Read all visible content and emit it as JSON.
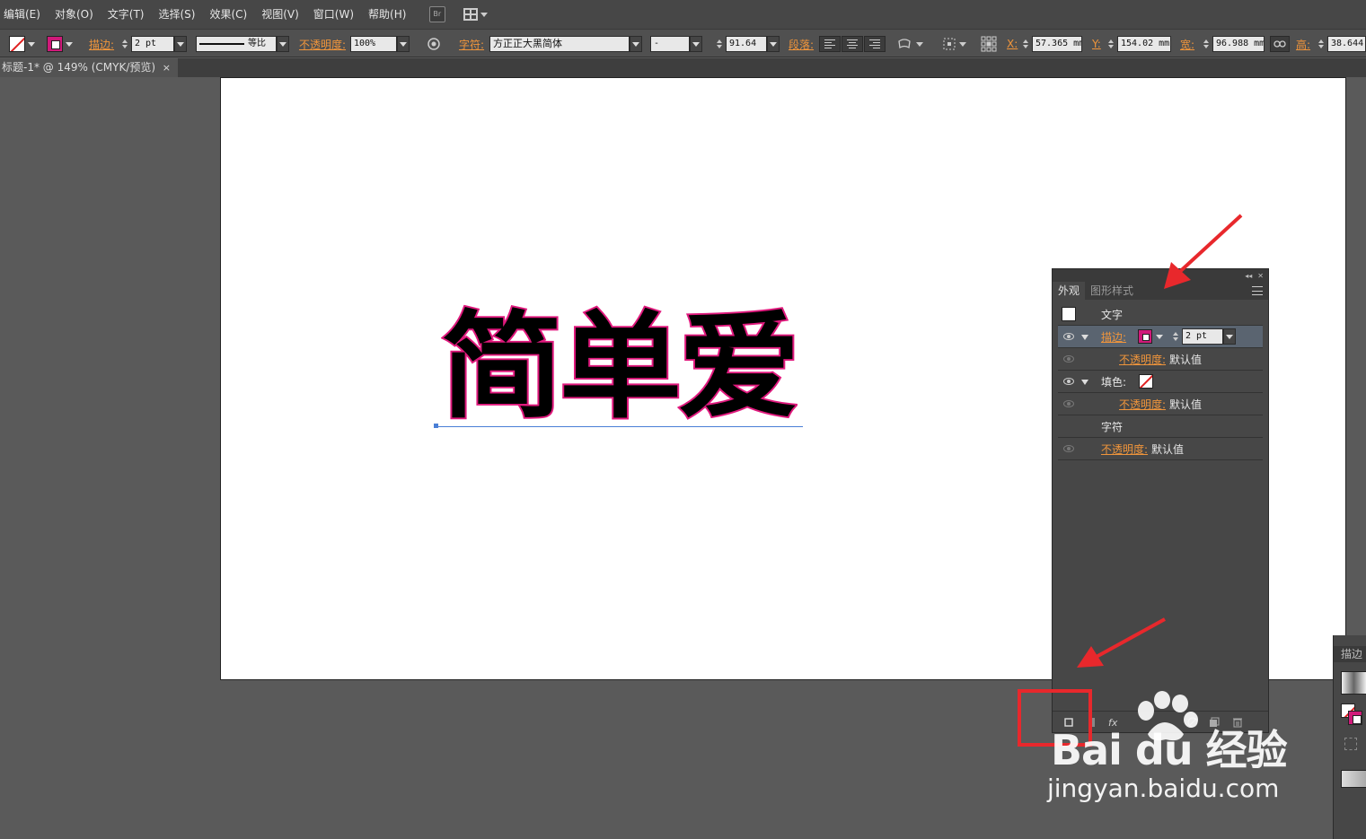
{
  "menubar": {
    "items": [
      "编辑(E)",
      "对象(O)",
      "文字(T)",
      "选择(S)",
      "效果(C)",
      "视图(V)",
      "窗口(W)",
      "帮助(H)"
    ],
    "bridge_icon": "br-icon",
    "layout_icon": "arrange-documents-icon"
  },
  "control_bar": {
    "stroke_label": "描边:",
    "stroke_weight": "2 pt",
    "stroke_profile": "等比",
    "opacity_label": "不透明度:",
    "opacity_value": "100%",
    "character_label": "字符:",
    "font_family": "方正正大黑简体",
    "font_style": "-",
    "font_size": "91.64",
    "paragraph_label": "段落:",
    "x_label": "X:",
    "x_value": "57.365 mm",
    "y_label": "Y:",
    "y_value": "154.02 mm",
    "w_label": "宽:",
    "w_value": "96.988 mm",
    "h_label": "高:",
    "h_value": "38.644"
  },
  "document": {
    "tab_title": "标题-1* @ 149% (CMYK/预览)",
    "close": "×"
  },
  "artboard": {
    "text": "简单爱",
    "fill_color": "#000000",
    "stroke_color": "#e0197d"
  },
  "appearance_panel": {
    "tabs": [
      "外观",
      "图形样式"
    ],
    "active_tab": "外观",
    "rows": {
      "object": "文字",
      "stroke_label": "描边:",
      "stroke_weight": "2 pt",
      "stroke_opacity_label": "不透明度:",
      "stroke_opacity_value": "默认值",
      "fill_label": "填色:",
      "fill_opacity_label": "不透明度:",
      "fill_opacity_value": "默认值",
      "characters": "字符",
      "opacity_label": "不透明度:",
      "opacity_value": "默认值"
    },
    "footer": {
      "fx": "fx"
    }
  },
  "stroke_panel": {
    "title": "描边"
  },
  "watermark": {
    "brand": "Bai du 经验",
    "url": "jingyan.baidu.com"
  },
  "colors": {
    "accent_orange": "#f0953b",
    "stroke_magenta": "#d01a7a",
    "annotation_red": "#e8282c",
    "selection_blue": "#4a7fd6"
  }
}
